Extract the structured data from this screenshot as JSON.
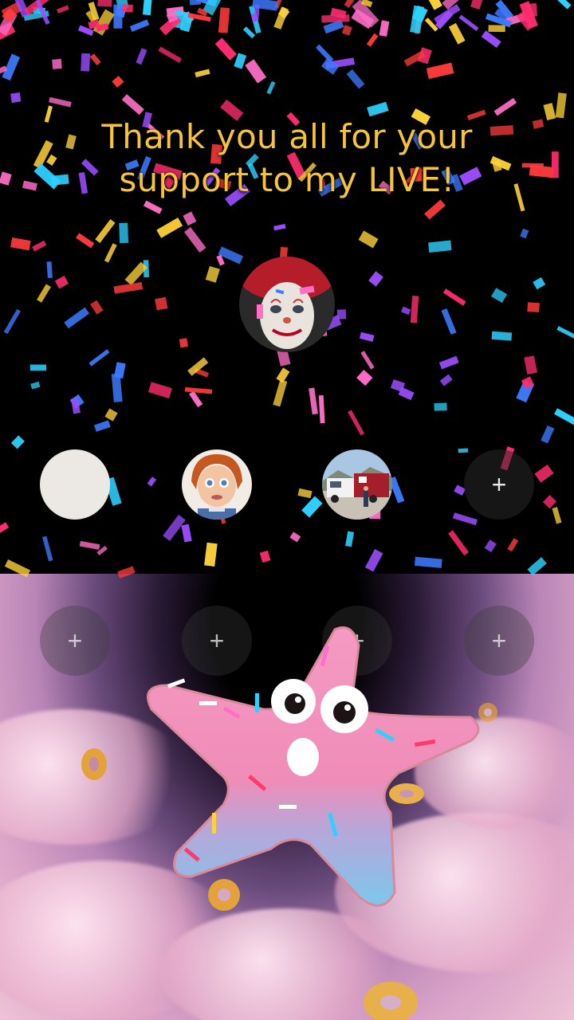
{
  "headline": {
    "text_line1": "Thank you all for your",
    "text_line2": "support to my LIVE!",
    "color": "#f6c33a"
  },
  "host": {
    "name": "host-avatar",
    "subject": "clown-face"
  },
  "guests": [
    {
      "name": "guest-slot-1",
      "state": "joined",
      "subject": "blank-light-avatar"
    },
    {
      "name": "guest-slot-2",
      "state": "joined",
      "subject": "doll-face"
    },
    {
      "name": "guest-slot-3",
      "state": "joined",
      "subject": "truck-photo"
    },
    {
      "name": "guest-slot-4",
      "state": "empty",
      "icon": "plus-icon",
      "label": "+"
    },
    {
      "name": "guest-slot-5",
      "state": "empty",
      "icon": "plus-icon",
      "label": "+"
    },
    {
      "name": "guest-slot-6",
      "state": "empty",
      "icon": "plus-icon",
      "label": "+"
    },
    {
      "name": "guest-slot-7",
      "state": "empty",
      "icon": "plus-icon",
      "label": "+"
    },
    {
      "name": "guest-slot-8",
      "state": "empty",
      "icon": "plus-icon",
      "label": "+"
    }
  ],
  "effect": {
    "name": "confetti-celebration",
    "background": "star-donut-character-in-clouds"
  },
  "colors": {
    "confetti": [
      "#ff2d6f",
      "#3d7bff",
      "#ffd23a",
      "#9b4dff",
      "#2ed0ff",
      "#ff3b3b",
      "#ff6ec7"
    ]
  }
}
